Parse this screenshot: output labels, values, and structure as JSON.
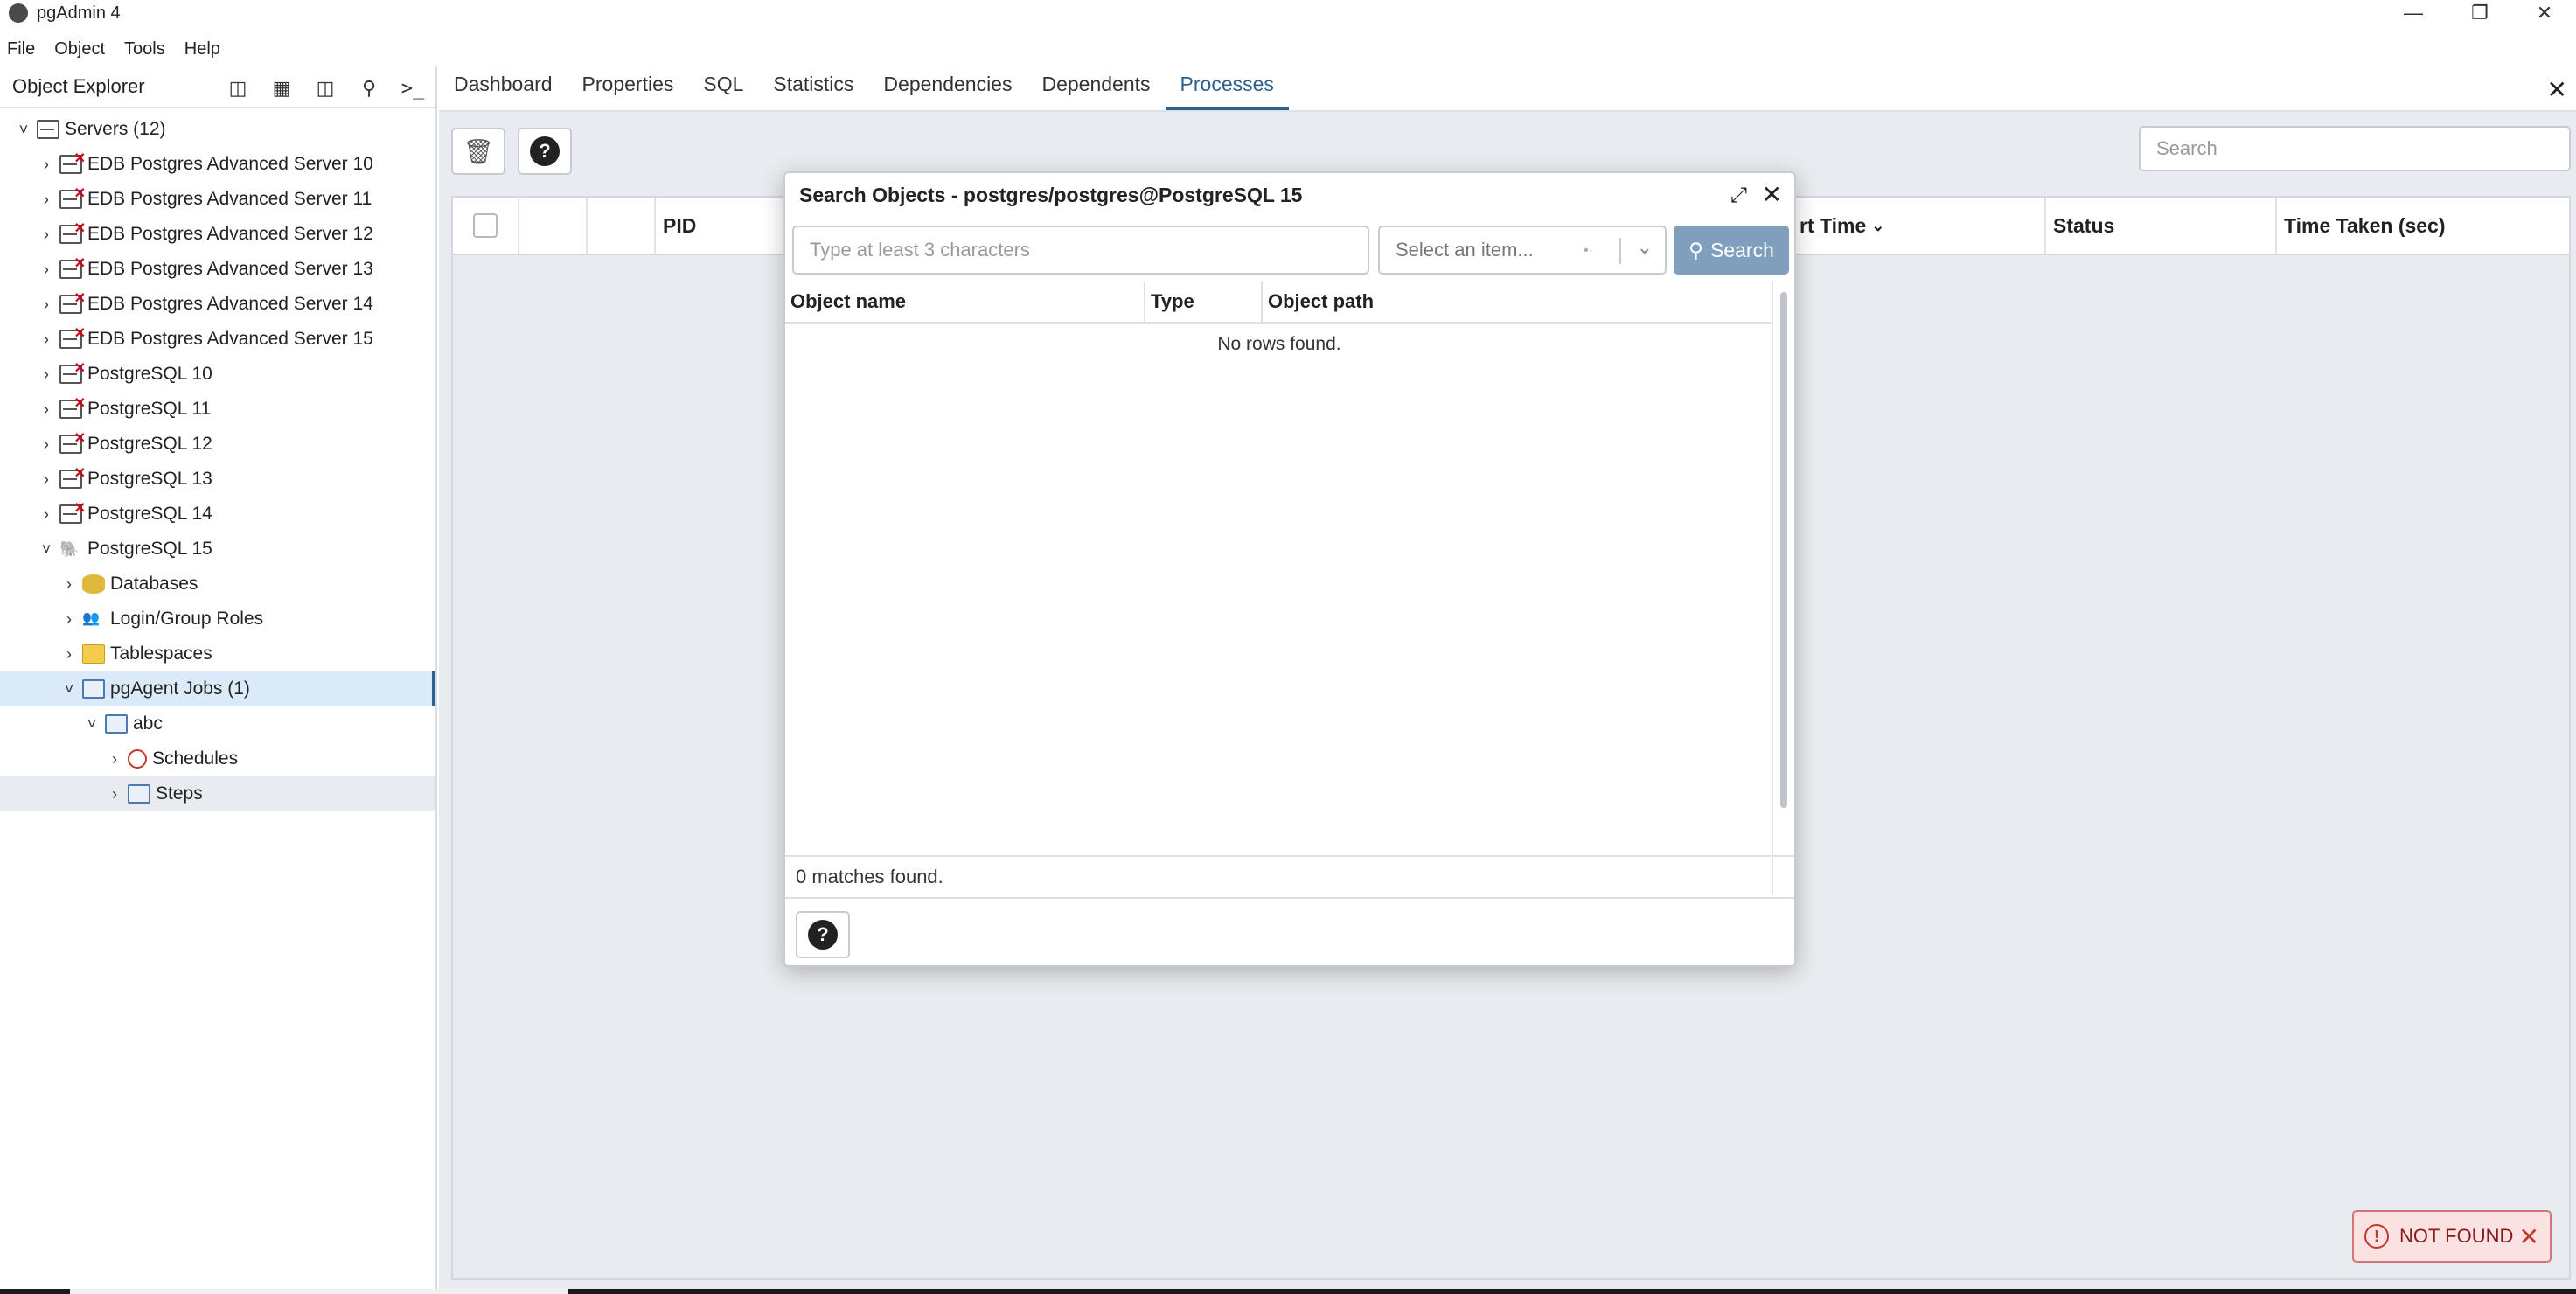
{
  "app": {
    "title": "pgAdmin 4"
  },
  "menu": [
    "File",
    "Object",
    "Tools",
    "Help"
  ],
  "object_explorer": {
    "title": "Object Explorer",
    "tree": [
      {
        "label": "Servers (12)",
        "level": 0,
        "chevron": "down",
        "icon": "servers-icon"
      },
      {
        "label": "EDB Postgres Advanced Server 10",
        "level": 1,
        "chevron": "right",
        "icon": "server-disconnected-icon"
      },
      {
        "label": "EDB Postgres Advanced Server 11",
        "level": 1,
        "chevron": "right",
        "icon": "server-disconnected-icon"
      },
      {
        "label": "EDB Postgres Advanced Server 12",
        "level": 1,
        "chevron": "right",
        "icon": "server-disconnected-icon"
      },
      {
        "label": "EDB Postgres Advanced Server 13",
        "level": 1,
        "chevron": "right",
        "icon": "server-disconnected-icon"
      },
      {
        "label": "EDB Postgres Advanced Server 14",
        "level": 1,
        "chevron": "right",
        "icon": "server-disconnected-icon"
      },
      {
        "label": "EDB Postgres Advanced Server 15",
        "level": 1,
        "chevron": "right",
        "icon": "server-disconnected-icon"
      },
      {
        "label": "PostgreSQL 10",
        "level": 1,
        "chevron": "right",
        "icon": "server-disconnected-icon"
      },
      {
        "label": "PostgreSQL 11",
        "level": 1,
        "chevron": "right",
        "icon": "server-disconnected-icon"
      },
      {
        "label": "PostgreSQL 12",
        "level": 1,
        "chevron": "right",
        "icon": "server-disconnected-icon"
      },
      {
        "label": "PostgreSQL 13",
        "level": 1,
        "chevron": "right",
        "icon": "server-disconnected-icon"
      },
      {
        "label": "PostgreSQL 14",
        "level": 1,
        "chevron": "right",
        "icon": "server-disconnected-icon"
      },
      {
        "label": "PostgreSQL 15",
        "level": 1,
        "chevron": "down",
        "icon": "postgres-elephant-icon"
      },
      {
        "label": "Databases",
        "level": 2,
        "chevron": "right",
        "icon": "databases-icon"
      },
      {
        "label": "Login/Group Roles",
        "level": 2,
        "chevron": "right",
        "icon": "roles-icon"
      },
      {
        "label": "Tablespaces",
        "level": 2,
        "chevron": "right",
        "icon": "tablespaces-icon"
      },
      {
        "label": "pgAgent Jobs (1)",
        "level": 2,
        "chevron": "down",
        "icon": "pgagent-jobs-icon",
        "state": "selected"
      },
      {
        "label": "abc",
        "level": 3,
        "chevron": "down",
        "icon": "job-icon"
      },
      {
        "label": "Schedules",
        "level": 4,
        "chevron": "right",
        "icon": "schedules-icon"
      },
      {
        "label": "Steps",
        "level": 4,
        "chevron": "right",
        "icon": "steps-icon",
        "state": "hover"
      }
    ]
  },
  "tabs": [
    "Dashboard",
    "Properties",
    "SQL",
    "Statistics",
    "Dependencies",
    "Dependents",
    "Processes"
  ],
  "active_tab": "Processes",
  "processes": {
    "search_placeholder": "Search",
    "columns": [
      "PID",
      "rt Time",
      "Status",
      "Time Taken (sec)"
    ]
  },
  "dialog": {
    "title": "Search Objects - postgres/postgres@PostgreSQL 15",
    "search_placeholder": "Type at least 3 characters",
    "type_select_placeholder": "Select an item...",
    "search_button": "Search",
    "columns": [
      "Object name",
      "Type",
      "Object path"
    ],
    "empty_text": "No rows found.",
    "matches_text": "0 matches found."
  },
  "toast": {
    "text": "NOT FOUND"
  },
  "colors": {
    "accent": "#2a5f8e",
    "selected_row": "#dbeaf8",
    "search_button": "#7f9fbd",
    "toast_bg": "#fbe2e2"
  }
}
